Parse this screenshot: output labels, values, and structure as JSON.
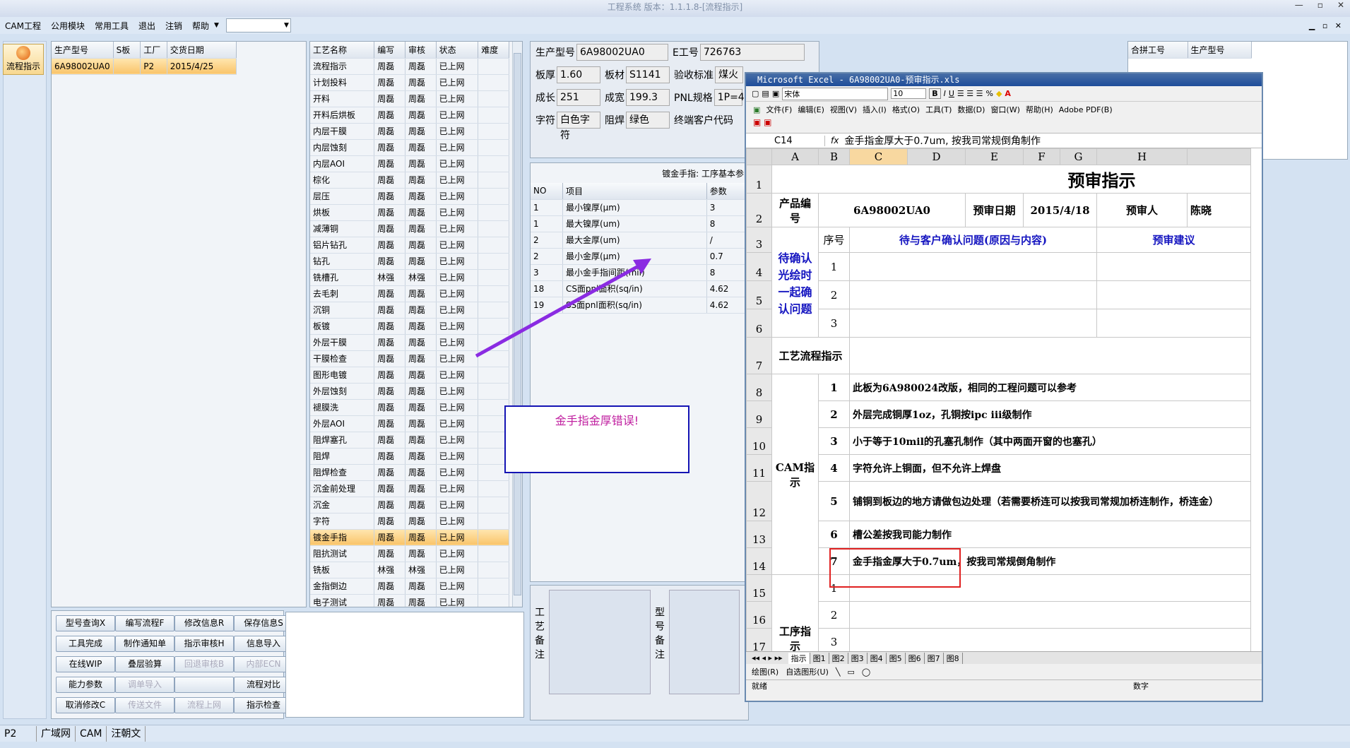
{
  "window": {
    "title": "工程系统 版本：1.1.1.8-[流程指示]"
  },
  "menu": {
    "items": [
      "CAM工程",
      "公用模块",
      "常用工具",
      "退出",
      "注销",
      "帮助"
    ]
  },
  "sidebar": {
    "button": "流程指示"
  },
  "model_table": {
    "headers": [
      "生产型号",
      "S板",
      "工厂",
      "交货日期"
    ],
    "rows": [
      [
        "6A98002UA0",
        "",
        "P2",
        "2015/4/25"
      ]
    ]
  },
  "process_table": {
    "headers": [
      "工艺名称",
      "编写",
      "审核",
      "状态",
      "难度"
    ],
    "rows": [
      [
        "流程指示",
        "周磊",
        "周磊",
        "已上网"
      ],
      [
        "计划投料",
        "周磊",
        "周磊",
        "已上网"
      ],
      [
        "开料",
        "周磊",
        "周磊",
        "已上网"
      ],
      [
        "开料后烘板",
        "周磊",
        "周磊",
        "已上网"
      ],
      [
        "内层干膜",
        "周磊",
        "周磊",
        "已上网"
      ],
      [
        "内层蚀刻",
        "周磊",
        "周磊",
        "已上网"
      ],
      [
        "内层AOI",
        "周磊",
        "周磊",
        "已上网"
      ],
      [
        "棕化",
        "周磊",
        "周磊",
        "已上网"
      ],
      [
        "层压",
        "周磊",
        "周磊",
        "已上网"
      ],
      [
        "烘板",
        "周磊",
        "周磊",
        "已上网"
      ],
      [
        "减薄铜",
        "周磊",
        "周磊",
        "已上网"
      ],
      [
        "铝片钻孔",
        "周磊",
        "周磊",
        "已上网"
      ],
      [
        "钻孔",
        "周磊",
        "周磊",
        "已上网"
      ],
      [
        "铣槽孔",
        "林强",
        "林强",
        "已上网"
      ],
      [
        "去毛刺",
        "周磊",
        "周磊",
        "已上网"
      ],
      [
        "沉铜",
        "周磊",
        "周磊",
        "已上网"
      ],
      [
        "板镀",
        "周磊",
        "周磊",
        "已上网"
      ],
      [
        "外层干膜",
        "周磊",
        "周磊",
        "已上网"
      ],
      [
        "干膜检查",
        "周磊",
        "周磊",
        "已上网"
      ],
      [
        "图形电镀",
        "周磊",
        "周磊",
        "已上网"
      ],
      [
        "外层蚀刻",
        "周磊",
        "周磊",
        "已上网"
      ],
      [
        "褪膜洗",
        "周磊",
        "周磊",
        "已上网"
      ],
      [
        "外层AOI",
        "周磊",
        "周磊",
        "已上网"
      ],
      [
        "阻焊塞孔",
        "周磊",
        "周磊",
        "已上网"
      ],
      [
        "阻焊",
        "周磊",
        "周磊",
        "已上网"
      ],
      [
        "阻焊检查",
        "周磊",
        "周磊",
        "已上网"
      ],
      [
        "沉金前处理",
        "周磊",
        "周磊",
        "已上网"
      ],
      [
        "沉金",
        "周磊",
        "周磊",
        "已上网"
      ],
      [
        "字符",
        "周磊",
        "周磊",
        "已上网"
      ],
      [
        "镀金手指",
        "周磊",
        "周磊",
        "已上网"
      ],
      [
        "阻抗测试",
        "周磊",
        "周磊",
        "已上网"
      ],
      [
        "铣板",
        "林强",
        "林强",
        "已上网"
      ],
      [
        "金指倒边",
        "周磊",
        "周磊",
        "已上网"
      ],
      [
        "电子测试",
        "周磊",
        "周磊",
        "已上网"
      ]
    ],
    "selected_index": 29
  },
  "buttons": [
    [
      "型号查询X",
      "编写流程F",
      "修改信息R",
      "保存信息S"
    ],
    [
      "工具完成",
      "制作通知单",
      "指示审核H",
      "信息导入"
    ],
    [
      "在线WIP",
      "叠层验算",
      "回退审核B",
      "内部ECN"
    ],
    [
      "能力参数",
      "调单导入",
      "",
      "流程对比"
    ],
    [
      "取消修改C",
      "传送文件",
      "流程上网",
      "指示检查"
    ]
  ],
  "disabled_buttons": [
    "回退审核B",
    "内部ECN",
    "调单导入",
    "传送文件",
    "流程上网"
  ],
  "info": {
    "model_label": "生产型号",
    "model": "6A98002UA0",
    "e_label": "E工号",
    "e": "726763",
    "thick_label": "板厚",
    "thick": "1.60",
    "mat_label": "板材",
    "mat": "S1141",
    "accept_label": "验收标准",
    "accept": "煤火",
    "len_label": "成长",
    "len": "251",
    "wid_label": "成宽",
    "wid": "199.3",
    "pnl_label": "PNL规格",
    "pnl": "1P=4",
    "char_label": "字符",
    "char": "白色字符",
    "mask_label": "阻焊",
    "mask": "绿色",
    "cust_label": "终端客户代码"
  },
  "param_title": "镀金手指: 工序基本参",
  "param_table": {
    "headers": [
      "NO",
      "项目",
      "参数"
    ],
    "rows": [
      [
        "1",
        "最小镍厚(μm)",
        "3"
      ],
      [
        "1",
        "最大镍厚(um)",
        "8"
      ],
      [
        "2",
        "最大金厚(um)",
        "/"
      ],
      [
        "2",
        "最小金厚(μm)",
        "0.7"
      ],
      [
        "3",
        "最小金手指间距(mil)",
        "8"
      ],
      [
        "18",
        "CS面pnl面积(sq/in)",
        "4.62"
      ],
      [
        "19",
        "SS面pnl面积(sq/in)",
        "4.62"
      ]
    ]
  },
  "merge_table": {
    "headers": [
      "合拼工号",
      "生产型号"
    ]
  },
  "annotation": "金手指金厚错误!",
  "notes": {
    "proc": "工艺备注",
    "model": "型号备注"
  },
  "statusbar": [
    "P2",
    "广域网",
    "CAM",
    "汪朝文"
  ],
  "excel": {
    "title": "Microsoft Excel - 6A98002UA0-预审指示.xls",
    "font": "宋体",
    "size": "10",
    "menu": [
      "文件(F)",
      "编辑(E)",
      "视图(V)",
      "插入(I)",
      "格式(O)",
      "工具(T)",
      "数据(D)",
      "窗口(W)",
      "帮助(H)",
      "Adobe PDF(B)"
    ],
    "cellref": "C14",
    "formula": "金手指金厚大于0.7um, 按我司常规倒角制作",
    "cols": [
      "A",
      "B",
      "C",
      "D",
      "E",
      "F",
      "G",
      "H"
    ],
    "heading": "预审指示",
    "r2": [
      "产品编号",
      "6A98002UA0",
      "预审日期",
      "2015/4/18",
      "预审人",
      "陈晓"
    ],
    "r3": [
      "序号",
      "待与客户确认问题(原因与内容)",
      "预审建议"
    ],
    "confirm_label": "待确认光绘时一起确认问题",
    "flow_label": "工艺流程指示",
    "cam_label": "CAM指示",
    "cam_items": [
      "此板为6A980024改版，相同的工程问题可以参考",
      "外层完成铜厚1oz，孔铜按ipc iii级制作",
      "小于等于10mil的孔塞孔制作（其中两面开窗的也塞孔）",
      "字符允许上铜面，但不允许上焊盘",
      "铺铜到板边的地方请做包边处理（若需要桥连可以按我司常规加桥连制作，桥连金）",
      "槽公差按我司能力制作",
      "金手指金厚大于0.7um，按我司常规倒角制作"
    ],
    "proc_label": "工序指示",
    "sheets": [
      "指示",
      "图1",
      "图2",
      "图3",
      "图4",
      "图5",
      "图6",
      "图7",
      "图8"
    ],
    "draw": "绘图(R)",
    "autoshape": "自选图形(U)",
    "status": "就绪",
    "num": "数字"
  }
}
